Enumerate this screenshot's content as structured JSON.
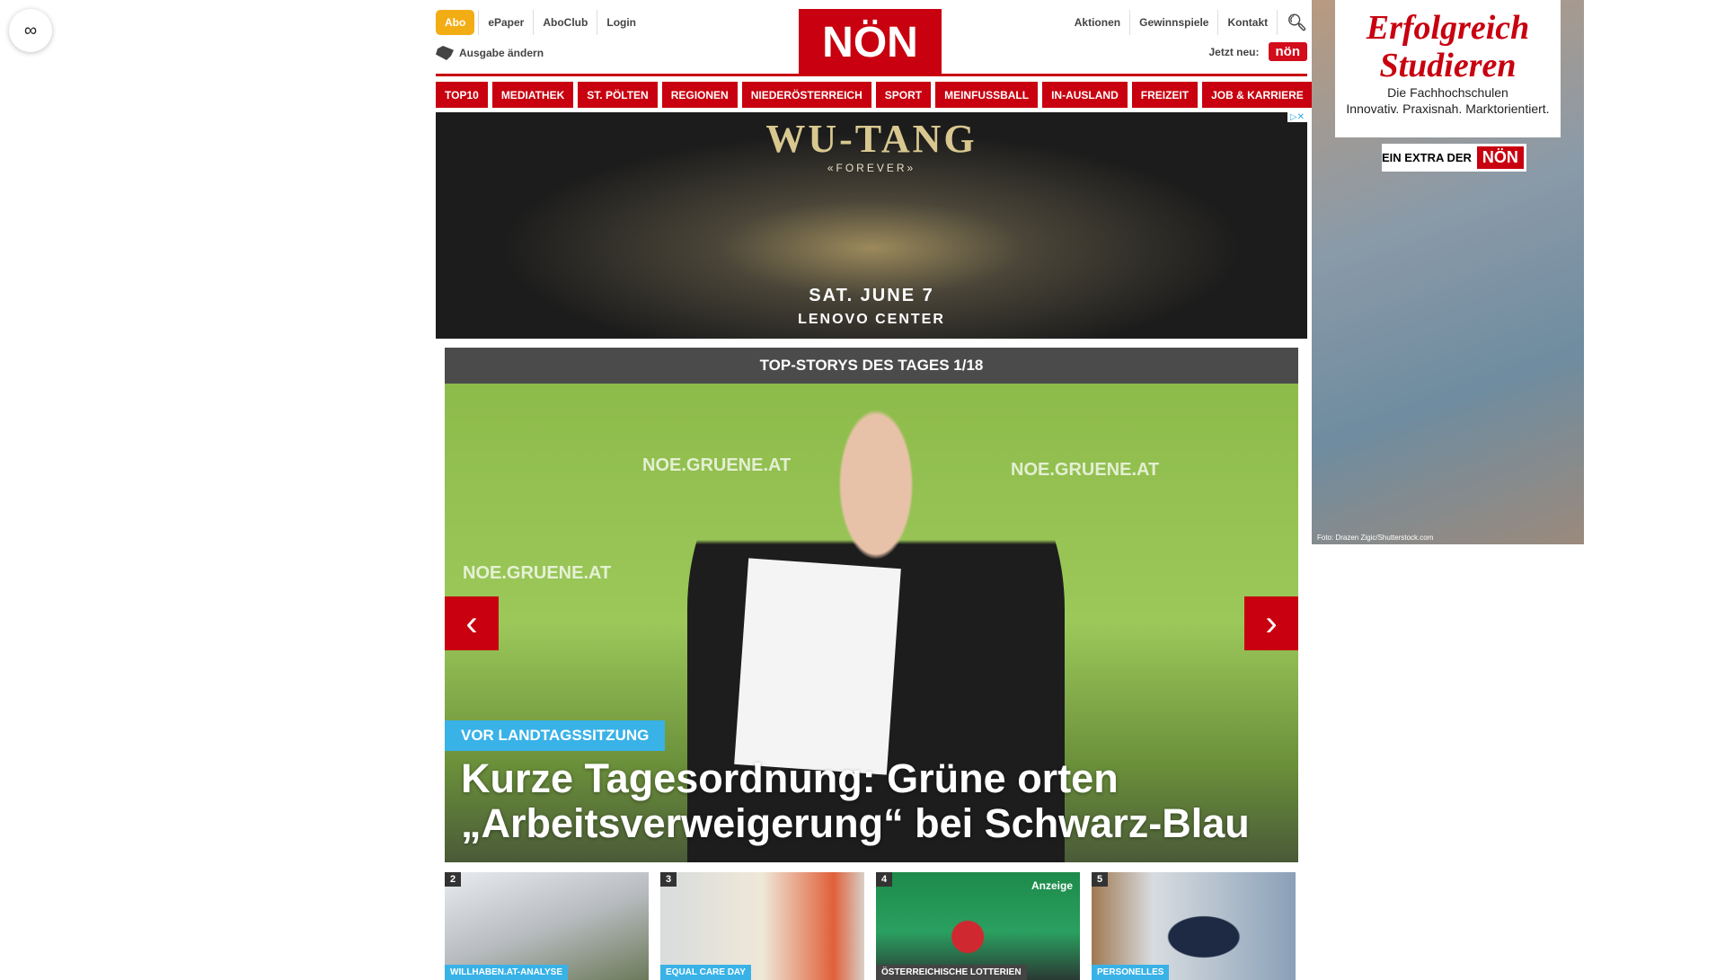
{
  "top_links": {
    "abo": "Abo",
    "epaper": "ePaper",
    "aboclub": "AboClub",
    "login": "Login",
    "ausgabe": "Ausgabe ändern"
  },
  "logo": "NÖN",
  "right_links": {
    "aktionen": "Aktionen",
    "gewinnspiele": "Gewinnspiele",
    "kontakt": "Kontakt",
    "jetzt_neu": "Jetzt neu:",
    "kleine_non": "nön"
  },
  "nav": [
    "TOP10",
    "MEDIATHEK",
    "ST. PÖLTEN",
    "REGIONEN",
    "NIEDERÖSTERREICH",
    "SPORT",
    "MEINFUSSBALL",
    "IN-AUSLAND",
    "FREIZEIT",
    "JOB & KARRIERE"
  ],
  "banner_ad": {
    "title": "WU-TANG",
    "subtitle": "«FOREVER»",
    "date": "SAT. JUNE 7",
    "venue": "LENOVO CENTER"
  },
  "slider": {
    "header": "TOP-STORYS DES TAGES 1/18",
    "tag": "VOR LANDTAGSSITZUNG",
    "headline": "Kurze Tagesordnung: Grüne orten „Arbeitsverweigerung“ bei Schwarz-Blau",
    "watermark": "NOE.GRUENE.AT"
  },
  "cards": [
    {
      "num": "2",
      "tag": "WILLHABEN.AT-ANALYSE"
    },
    {
      "num": "3",
      "tag": "EQUAL CARE DAY"
    },
    {
      "num": "4",
      "tag": "ÖSTERREICHISCHE LOTTERIEN",
      "badge": "Anzeige"
    },
    {
      "num": "5",
      "tag": "PERSONELLES"
    }
  ],
  "side_ad": {
    "headline": "Erfolgreich Studieren",
    "line1": "Die Fachhochschulen",
    "line2": "Innovativ. Praxisnah. Marktorientiert.",
    "extra": "EIN EXTRA DER",
    "brand": "NÖN",
    "credit": "Foto: Drazen Zigic/Shutterstock.com"
  },
  "colors": {
    "brand_red": "#c8000f",
    "accent_blue": "#39b2e7",
    "abo_orange": "#f3ad14"
  }
}
